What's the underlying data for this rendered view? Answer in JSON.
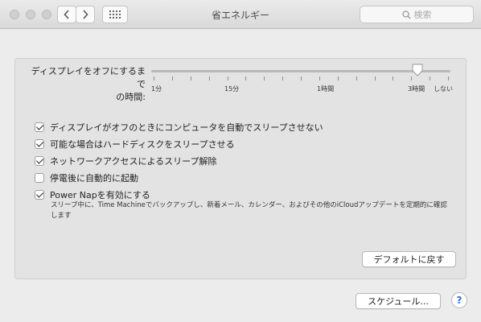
{
  "window": {
    "title": "省エネルギー",
    "search_placeholder": "検索"
  },
  "slider": {
    "label_line1": "ディスプレイをオフにするまで",
    "label_line2": "の時間:",
    "tick_labels": [
      "1分",
      "15分",
      "1時間",
      "3時間",
      "しない"
    ],
    "value": "3時間"
  },
  "options": [
    {
      "label": "ディスプレイがオフのときにコンピュータを自動でスリープさせない",
      "checked": true
    },
    {
      "label": "可能な場合はハードディスクをスリープさせる",
      "checked": true
    },
    {
      "label": "ネットワークアクセスによるスリープ解除",
      "checked": true
    },
    {
      "label": "停電後に自動的に起動",
      "checked": false
    },
    {
      "label": "Power Napを有効にする",
      "checked": true
    }
  ],
  "power_nap_description": "スリープ中に、Time Machineでバックアップし、新着メール、カレンダー、およびその他のiCloudアップデートを定期的に確認します",
  "buttons": {
    "restore_defaults": "デフォルトに戻す",
    "schedule": "スケジュール...",
    "help": "?"
  }
}
